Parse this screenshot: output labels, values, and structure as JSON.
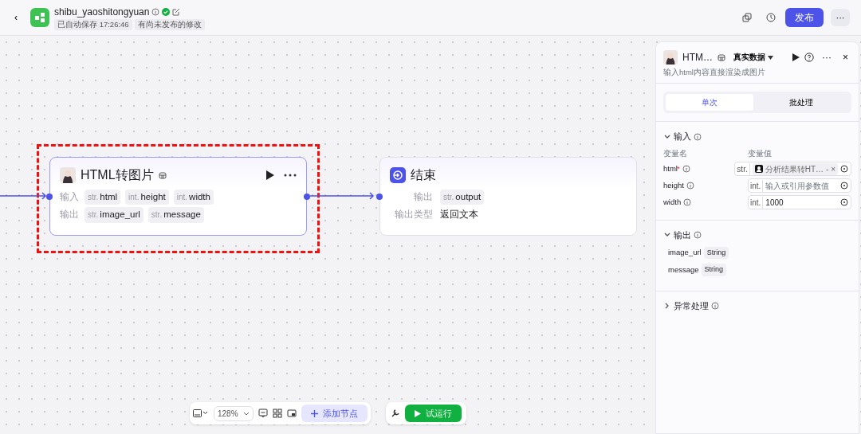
{
  "header": {
    "back": "‹",
    "app_name": "shibu_yaoshitongyuan",
    "published_ok": true,
    "tags": [
      "已自动保存 17:26:46",
      "有尚未发布的修改"
    ],
    "publish_button": "发布",
    "more_button": "···"
  },
  "canvas": {
    "nodes": [
      {
        "kind": "plugin",
        "title": "HTML转图片",
        "highlighted": true,
        "has_input_port": true,
        "has_output_port": true,
        "rows": [
          {
            "label": "输入",
            "chips": [
              {
                "type": "str.",
                "name": "html"
              },
              {
                "type": "int.",
                "name": "height"
              },
              {
                "type": "int.",
                "name": "width"
              }
            ]
          },
          {
            "label": "输出",
            "chips": [
              {
                "type": "str.",
                "name": "image_url"
              },
              {
                "type": "str.",
                "name": "message"
              }
            ]
          }
        ]
      },
      {
        "kind": "end",
        "title": "结束",
        "highlighted": false,
        "has_input_port": true,
        "has_output_port": false,
        "rows": [
          {
            "label": "输出",
            "chips": [
              {
                "type": "str.",
                "name": "output"
              }
            ]
          },
          {
            "label": "输出类型",
            "value": "返回文本"
          }
        ]
      }
    ]
  },
  "panel": {
    "title": "HTM…",
    "data_source": "真实数据",
    "more": "···",
    "close": "×",
    "description": "输入html内容直接渲染成图片",
    "tabs": [
      {
        "label": "单次",
        "selected": true
      },
      {
        "label": "批处理",
        "selected": false
      }
    ],
    "input_section": {
      "title": "输入",
      "expanded": true,
      "columns": [
        "变量名",
        "变量值"
      ],
      "params": [
        {
          "name": "html",
          "required_mark": "*",
          "type": "str.",
          "reference": "分析结果转HT…",
          "clear": "- ×"
        },
        {
          "name": "height",
          "type": "int.",
          "placeholder": "输入或引用参数值"
        },
        {
          "name": "width",
          "type": "int.",
          "value": "1000"
        }
      ]
    },
    "output_section": {
      "title": "输出",
      "expanded": true,
      "outputs": [
        {
          "name": "image_url",
          "type": "String"
        },
        {
          "name": "message",
          "type": "String"
        }
      ]
    },
    "error_section": {
      "title": "异常处理",
      "expanded": false
    }
  },
  "toolbar": {
    "zoom": "128%",
    "add_node": "添加节点",
    "test_run": "试运行"
  }
}
